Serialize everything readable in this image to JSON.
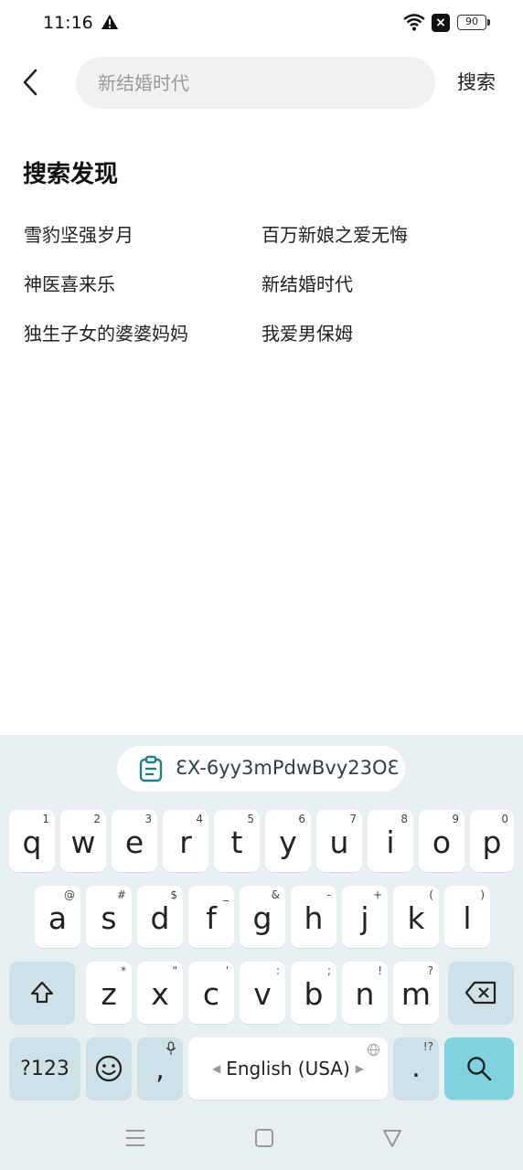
{
  "status_bar": {
    "time": "11:16",
    "battery": "90",
    "icons": [
      "warning-icon",
      "wifi-icon",
      "sim-blocked-icon",
      "battery-icon"
    ]
  },
  "search": {
    "placeholder": "新结婚时代",
    "value": "",
    "button_label": "搜索",
    "back_icon": "chevron-left-icon"
  },
  "discovery": {
    "title": "搜索发现",
    "items": [
      {
        "label": "雪豹坚强岁月"
      },
      {
        "label": "百万新娘之爱无悔"
      },
      {
        "label": "神医喜来乐"
      },
      {
        "label": "新结婚时代"
      },
      {
        "label": "独生子女的婆婆妈妈"
      },
      {
        "label": "我爱男保姆"
      }
    ]
  },
  "keyboard": {
    "clipboard_text": "ƐX-6yy3mPdwBvy23OƐ",
    "row1": [
      {
        "label": "q",
        "hint": "1"
      },
      {
        "label": "w",
        "hint": "2"
      },
      {
        "label": "e",
        "hint": "3"
      },
      {
        "label": "r",
        "hint": "4"
      },
      {
        "label": "t",
        "hint": "5"
      },
      {
        "label": "y",
        "hint": "6"
      },
      {
        "label": "u",
        "hint": "7"
      },
      {
        "label": "i",
        "hint": "8"
      },
      {
        "label": "o",
        "hint": "9"
      },
      {
        "label": "p",
        "hint": "0"
      }
    ],
    "row2": [
      {
        "label": "a",
        "hint": "@"
      },
      {
        "label": "s",
        "hint": "#"
      },
      {
        "label": "d",
        "hint": "$"
      },
      {
        "label": "f",
        "hint": "_"
      },
      {
        "label": "g",
        "hint": "&"
      },
      {
        "label": "h",
        "hint": "-"
      },
      {
        "label": "j",
        "hint": "+"
      },
      {
        "label": "k",
        "hint": "("
      },
      {
        "label": "l",
        "hint": ")"
      }
    ],
    "row3": [
      {
        "label": "z",
        "hint": "*"
      },
      {
        "label": "x",
        "hint": "\""
      },
      {
        "label": "c",
        "hint": "'"
      },
      {
        "label": "v",
        "hint": ":"
      },
      {
        "label": "b",
        "hint": ";"
      },
      {
        "label": "n",
        "hint": "!"
      },
      {
        "label": "m",
        "hint": "?"
      }
    ],
    "symbols_label": "?123",
    "comma_label": ",",
    "space_label": "English (USA)",
    "period_label": ".",
    "period_hint": "!?"
  },
  "colors": {
    "keyboard_bg": "#e8eff2",
    "function_key": "#cfe1e8",
    "action_key": "#7fd3e0",
    "clip_icon": "#1f7f86"
  }
}
